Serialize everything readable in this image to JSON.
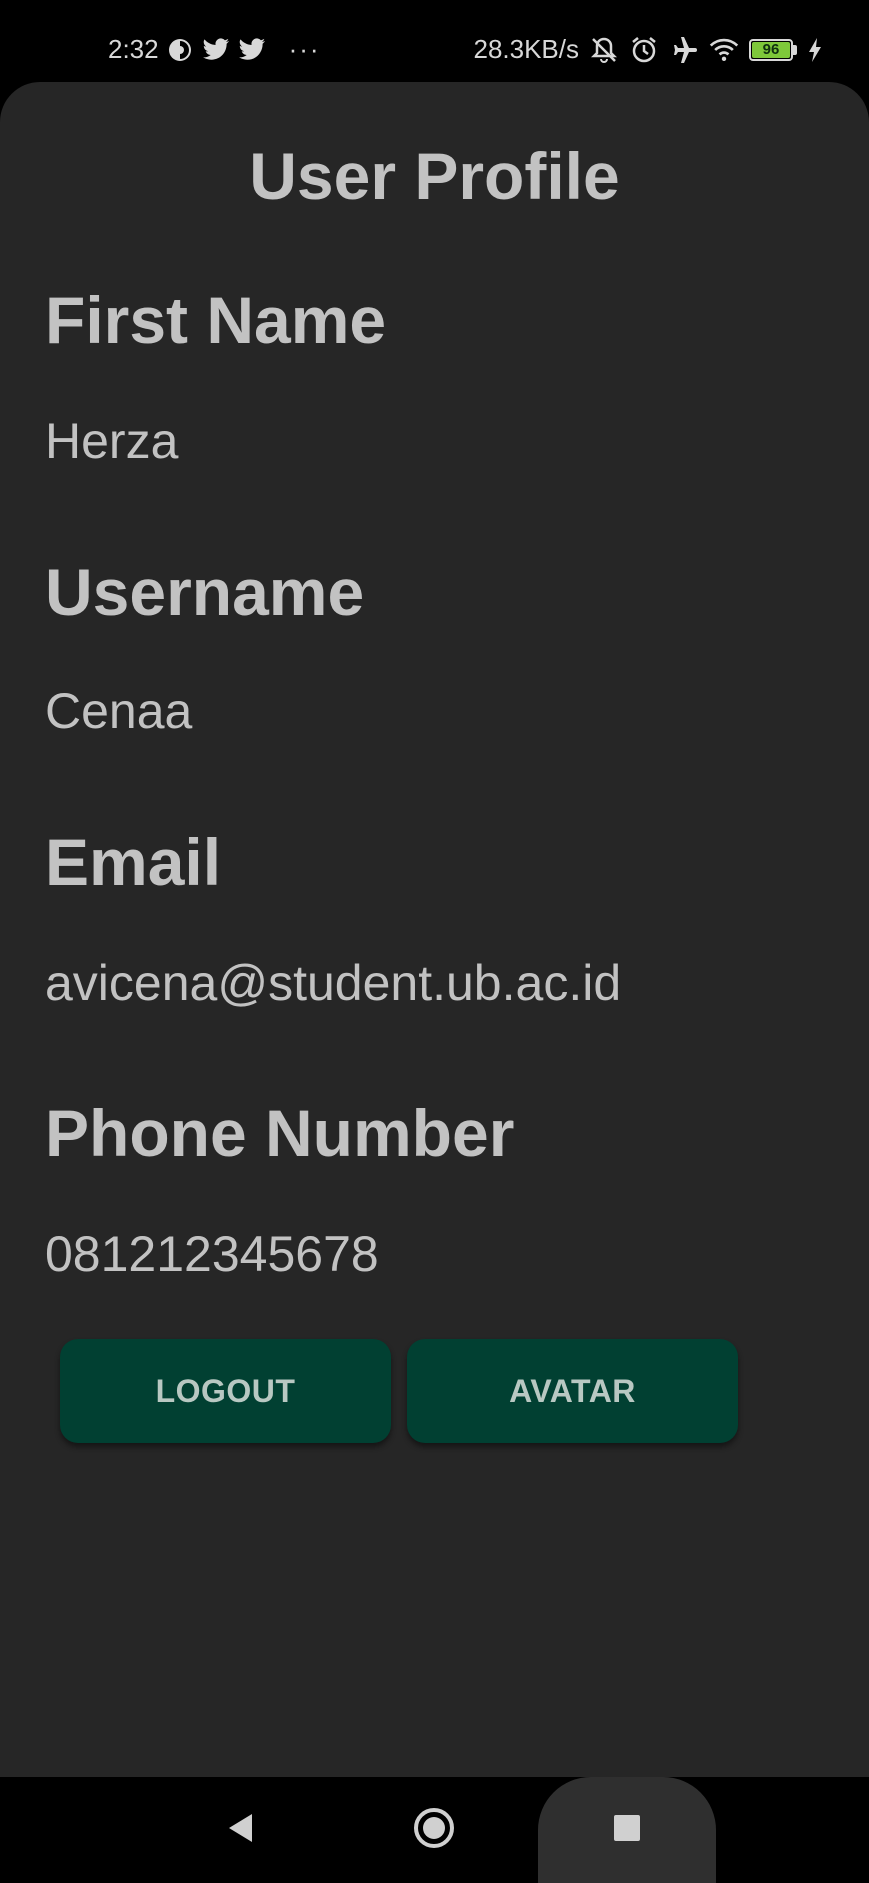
{
  "status_bar": {
    "time": "2:32",
    "left_icons": [
      "data-saver-icon",
      "twitter-icon",
      "twitter-icon",
      "more-notifications-icon"
    ],
    "more_dots": "···",
    "network_speed": "28.3KB/s",
    "right_icons": [
      "silent-icon",
      "alarm-icon",
      "airplane-icon",
      "wifi-icon"
    ],
    "battery_level": "96",
    "battery_fill_fraction": 0.96,
    "battery_color": "#7ec83a"
  },
  "profile": {
    "title": "User Profile",
    "fields": [
      {
        "label": "First Name",
        "value": "Herza"
      },
      {
        "label": "Username",
        "value": "Cenaa"
      },
      {
        "label": "Email",
        "value": "avicena@student.ub.ac.id"
      },
      {
        "label": "Phone Number",
        "value": "081212345678"
      }
    ]
  },
  "buttons": {
    "logout_label": "LOGOUT",
    "avatar_label": "AVATAR",
    "color": "#014032"
  },
  "nav_bar": {
    "back_icon": "back-triangle-icon",
    "home_icon": "home-circle-icon",
    "recents_icon": "recents-square-icon"
  }
}
